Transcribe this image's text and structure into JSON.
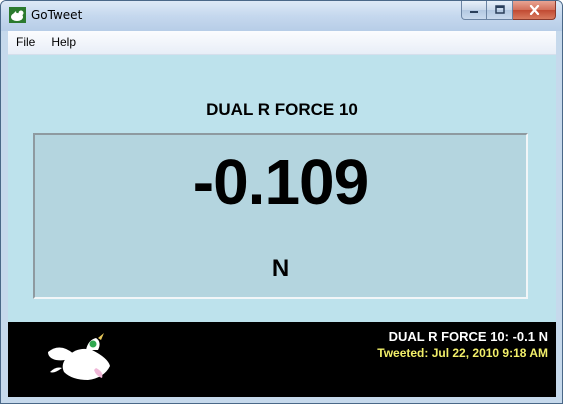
{
  "window": {
    "title": "GoTweet",
    "icon": "bird-icon"
  },
  "menu": {
    "items": [
      "File",
      "Help"
    ]
  },
  "reading": {
    "sensor_name": "DUAL R FORCE 10",
    "value": "-0.109",
    "unit": "N"
  },
  "tweet": {
    "message": "DUAL R FORCE 10: -0.1 N",
    "timestamp": "Tweeted: Jul 22, 2010 9:18 AM"
  },
  "colors": {
    "client_background": "#bde2ec",
    "panel_background": "#b4d5df",
    "tweetbar_background": "#000000",
    "tweet_message": "#ffffff",
    "tweet_timestamp": "#f2ef6a"
  }
}
